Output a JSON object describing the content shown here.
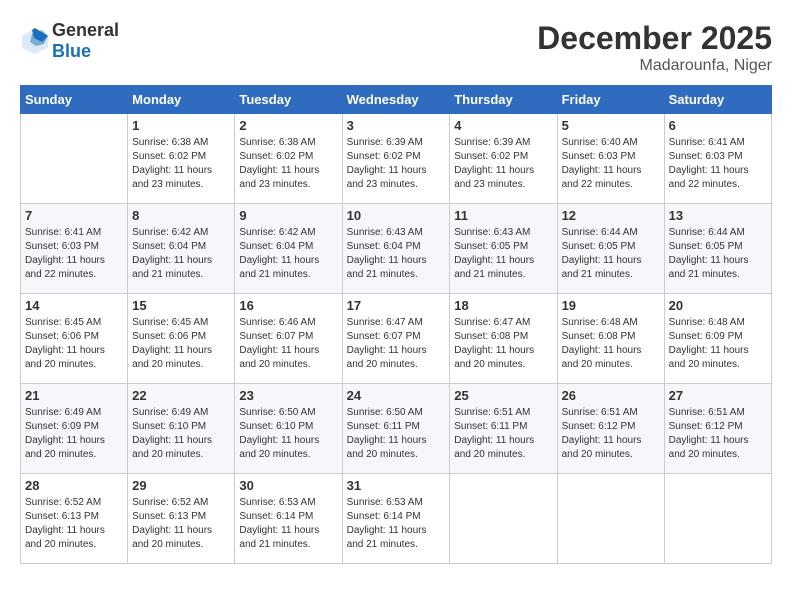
{
  "header": {
    "logo_general": "General",
    "logo_blue": "Blue",
    "month_title": "December 2025",
    "location": "Madarounfa, Niger"
  },
  "days_of_week": [
    "Sunday",
    "Monday",
    "Tuesday",
    "Wednesday",
    "Thursday",
    "Friday",
    "Saturday"
  ],
  "weeks": [
    [
      {
        "day": "",
        "sunrise": "",
        "sunset": "",
        "daylight": ""
      },
      {
        "day": "1",
        "sunrise": "Sunrise: 6:38 AM",
        "sunset": "Sunset: 6:02 PM",
        "daylight": "Daylight: 11 hours and 23 minutes."
      },
      {
        "day": "2",
        "sunrise": "Sunrise: 6:38 AM",
        "sunset": "Sunset: 6:02 PM",
        "daylight": "Daylight: 11 hours and 23 minutes."
      },
      {
        "day": "3",
        "sunrise": "Sunrise: 6:39 AM",
        "sunset": "Sunset: 6:02 PM",
        "daylight": "Daylight: 11 hours and 23 minutes."
      },
      {
        "day": "4",
        "sunrise": "Sunrise: 6:39 AM",
        "sunset": "Sunset: 6:02 PM",
        "daylight": "Daylight: 11 hours and 23 minutes."
      },
      {
        "day": "5",
        "sunrise": "Sunrise: 6:40 AM",
        "sunset": "Sunset: 6:03 PM",
        "daylight": "Daylight: 11 hours and 22 minutes."
      },
      {
        "day": "6",
        "sunrise": "Sunrise: 6:41 AM",
        "sunset": "Sunset: 6:03 PM",
        "daylight": "Daylight: 11 hours and 22 minutes."
      }
    ],
    [
      {
        "day": "7",
        "sunrise": "Sunrise: 6:41 AM",
        "sunset": "Sunset: 6:03 PM",
        "daylight": "Daylight: 11 hours and 22 minutes."
      },
      {
        "day": "8",
        "sunrise": "Sunrise: 6:42 AM",
        "sunset": "Sunset: 6:04 PM",
        "daylight": "Daylight: 11 hours and 21 minutes."
      },
      {
        "day": "9",
        "sunrise": "Sunrise: 6:42 AM",
        "sunset": "Sunset: 6:04 PM",
        "daylight": "Daylight: 11 hours and 21 minutes."
      },
      {
        "day": "10",
        "sunrise": "Sunrise: 6:43 AM",
        "sunset": "Sunset: 6:04 PM",
        "daylight": "Daylight: 11 hours and 21 minutes."
      },
      {
        "day": "11",
        "sunrise": "Sunrise: 6:43 AM",
        "sunset": "Sunset: 6:05 PM",
        "daylight": "Daylight: 11 hours and 21 minutes."
      },
      {
        "day": "12",
        "sunrise": "Sunrise: 6:44 AM",
        "sunset": "Sunset: 6:05 PM",
        "daylight": "Daylight: 11 hours and 21 minutes."
      },
      {
        "day": "13",
        "sunrise": "Sunrise: 6:44 AM",
        "sunset": "Sunset: 6:05 PM",
        "daylight": "Daylight: 11 hours and 21 minutes."
      }
    ],
    [
      {
        "day": "14",
        "sunrise": "Sunrise: 6:45 AM",
        "sunset": "Sunset: 6:06 PM",
        "daylight": "Daylight: 11 hours and 20 minutes."
      },
      {
        "day": "15",
        "sunrise": "Sunrise: 6:45 AM",
        "sunset": "Sunset: 6:06 PM",
        "daylight": "Daylight: 11 hours and 20 minutes."
      },
      {
        "day": "16",
        "sunrise": "Sunrise: 6:46 AM",
        "sunset": "Sunset: 6:07 PM",
        "daylight": "Daylight: 11 hours and 20 minutes."
      },
      {
        "day": "17",
        "sunrise": "Sunrise: 6:47 AM",
        "sunset": "Sunset: 6:07 PM",
        "daylight": "Daylight: 11 hours and 20 minutes."
      },
      {
        "day": "18",
        "sunrise": "Sunrise: 6:47 AM",
        "sunset": "Sunset: 6:08 PM",
        "daylight": "Daylight: 11 hours and 20 minutes."
      },
      {
        "day": "19",
        "sunrise": "Sunrise: 6:48 AM",
        "sunset": "Sunset: 6:08 PM",
        "daylight": "Daylight: 11 hours and 20 minutes."
      },
      {
        "day": "20",
        "sunrise": "Sunrise: 6:48 AM",
        "sunset": "Sunset: 6:09 PM",
        "daylight": "Daylight: 11 hours and 20 minutes."
      }
    ],
    [
      {
        "day": "21",
        "sunrise": "Sunrise: 6:49 AM",
        "sunset": "Sunset: 6:09 PM",
        "daylight": "Daylight: 11 hours and 20 minutes."
      },
      {
        "day": "22",
        "sunrise": "Sunrise: 6:49 AM",
        "sunset": "Sunset: 6:10 PM",
        "daylight": "Daylight: 11 hours and 20 minutes."
      },
      {
        "day": "23",
        "sunrise": "Sunrise: 6:50 AM",
        "sunset": "Sunset: 6:10 PM",
        "daylight": "Daylight: 11 hours and 20 minutes."
      },
      {
        "day": "24",
        "sunrise": "Sunrise: 6:50 AM",
        "sunset": "Sunset: 6:11 PM",
        "daylight": "Daylight: 11 hours and 20 minutes."
      },
      {
        "day": "25",
        "sunrise": "Sunrise: 6:51 AM",
        "sunset": "Sunset: 6:11 PM",
        "daylight": "Daylight: 11 hours and 20 minutes."
      },
      {
        "day": "26",
        "sunrise": "Sunrise: 6:51 AM",
        "sunset": "Sunset: 6:12 PM",
        "daylight": "Daylight: 11 hours and 20 minutes."
      },
      {
        "day": "27",
        "sunrise": "Sunrise: 6:51 AM",
        "sunset": "Sunset: 6:12 PM",
        "daylight": "Daylight: 11 hours and 20 minutes."
      }
    ],
    [
      {
        "day": "28",
        "sunrise": "Sunrise: 6:52 AM",
        "sunset": "Sunset: 6:13 PM",
        "daylight": "Daylight: 11 hours and 20 minutes."
      },
      {
        "day": "29",
        "sunrise": "Sunrise: 6:52 AM",
        "sunset": "Sunset: 6:13 PM",
        "daylight": "Daylight: 11 hours and 20 minutes."
      },
      {
        "day": "30",
        "sunrise": "Sunrise: 6:53 AM",
        "sunset": "Sunset: 6:14 PM",
        "daylight": "Daylight: 11 hours and 21 minutes."
      },
      {
        "day": "31",
        "sunrise": "Sunrise: 6:53 AM",
        "sunset": "Sunset: 6:14 PM",
        "daylight": "Daylight: 11 hours and 21 minutes."
      },
      {
        "day": "",
        "sunrise": "",
        "sunset": "",
        "daylight": ""
      },
      {
        "day": "",
        "sunrise": "",
        "sunset": "",
        "daylight": ""
      },
      {
        "day": "",
        "sunrise": "",
        "sunset": "",
        "daylight": ""
      }
    ]
  ]
}
